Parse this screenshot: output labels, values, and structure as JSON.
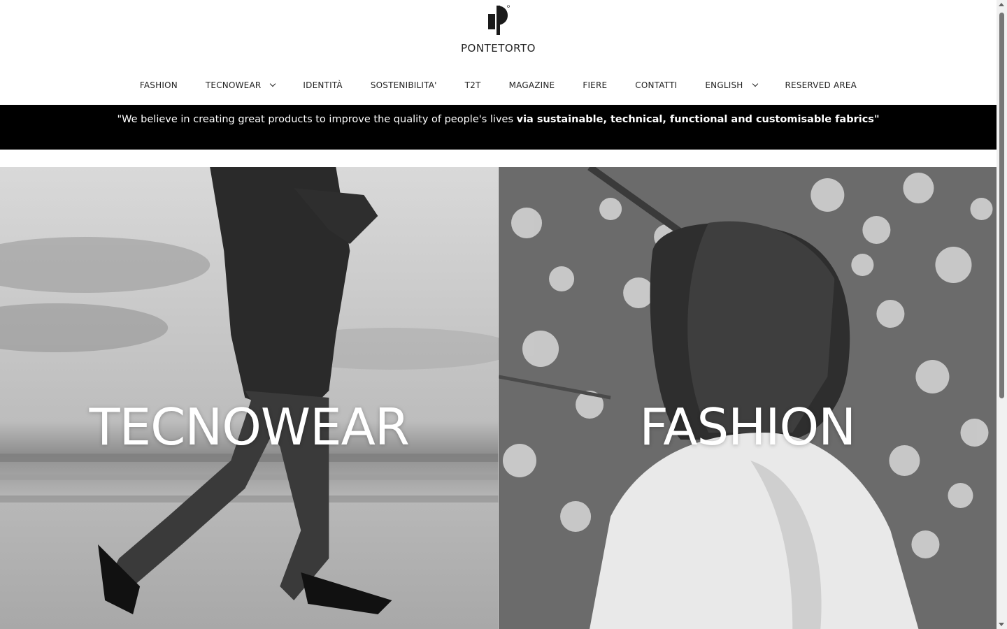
{
  "brand": {
    "name": "PONTETORTO"
  },
  "nav": {
    "items": [
      {
        "label": "FASHION",
        "dropdown": false
      },
      {
        "label": "TECNOWEAR",
        "dropdown": true
      },
      {
        "label": "IDENTITÀ",
        "dropdown": false
      },
      {
        "label": "SOSTENIBILITA'",
        "dropdown": false
      },
      {
        "label": "T2T",
        "dropdown": false
      },
      {
        "label": "MAGAZINE",
        "dropdown": false
      },
      {
        "label": "FIERE",
        "dropdown": false
      },
      {
        "label": "CONTATTI",
        "dropdown": false
      },
      {
        "label": "ENGLISH",
        "dropdown": true
      },
      {
        "label": "RESERVED AREA",
        "dropdown": false
      }
    ]
  },
  "banner": {
    "text_regular": "\"We believe in creating great products to improve the quality of people's lives",
    "text_bold": "via sustainable, technical, functional and customisable fabrics\""
  },
  "panels": {
    "left": {
      "title": "TECNOWEAR"
    },
    "right": {
      "title": "FASHION"
    }
  },
  "colors": {
    "banner_bg": "#000000",
    "text": "#222222"
  }
}
